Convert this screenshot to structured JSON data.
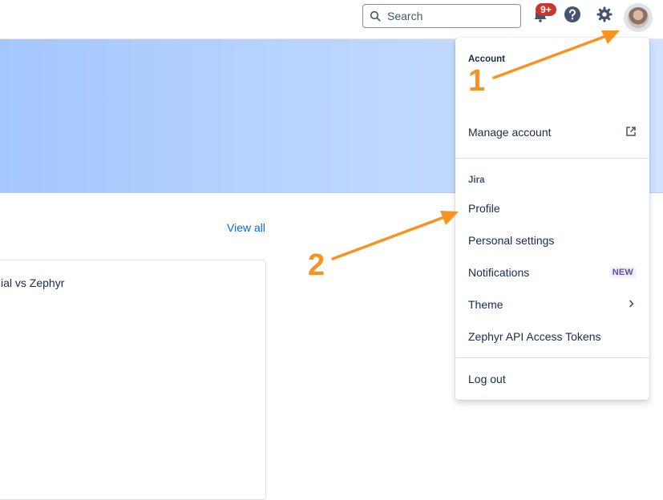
{
  "topbar": {
    "search_placeholder": "Search",
    "notifications_count": "9+",
    "icons": {
      "search": "search-icon",
      "notifications": "bell-icon",
      "help": "help-icon",
      "settings": "gear-icon",
      "avatar": "avatar"
    }
  },
  "main": {
    "view_all_label": "View all",
    "card_title": "ial vs Zephyr"
  },
  "account_menu": {
    "account_heading": "Account",
    "manage_account_label": "Manage account",
    "jira_heading": "Jira",
    "items": [
      {
        "label": "Profile"
      },
      {
        "label": "Personal settings"
      },
      {
        "label": "Notifications",
        "badge": "NEW"
      },
      {
        "label": "Theme"
      },
      {
        "label": "Zephyr API Access Tokens"
      }
    ],
    "logout_label": "Log out"
  },
  "annotations": {
    "marker_1": "1",
    "marker_2": "2",
    "color": "#f7931e"
  },
  "colors": {
    "accent_link": "#0c66e4",
    "badge_red": "#c9372c",
    "new_lozenge_text": "#5e4db2"
  }
}
